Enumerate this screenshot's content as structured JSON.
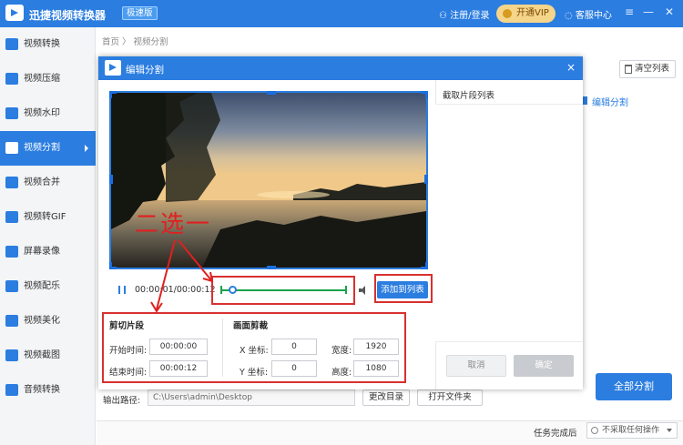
{
  "app": {
    "name": "迅捷视频转换器",
    "edition_badge": "极速版",
    "login_label": "注册/登录",
    "vip_label": "开通VIP",
    "support_label": "客服中心"
  },
  "sidebar": {
    "items": [
      {
        "label": "视频转换"
      },
      {
        "label": "视频压缩"
      },
      {
        "label": "视频水印"
      },
      {
        "label": "视频分割"
      },
      {
        "label": "视频合并"
      },
      {
        "label": "视频转GIF"
      },
      {
        "label": "屏幕录像"
      },
      {
        "label": "视频配乐"
      },
      {
        "label": "视频美化"
      },
      {
        "label": "视频截图"
      },
      {
        "label": "音频转换"
      }
    ],
    "active_index": 3
  },
  "breadcrumb": "首页 〉 视频分割",
  "main": {
    "clear_list_label": "清空列表",
    "right_item_label": "编辑分割",
    "split_all_label": "全部分割",
    "output_label": "输出路径:",
    "output_path": "C:\\Users\\admin\\Desktop",
    "change_dir_label": "更改目录",
    "open_folder_label": "打开文件夹",
    "on_complete_label": "任务完成后",
    "on_complete_value": "不采取任何操作"
  },
  "dialog": {
    "title": "编辑分割",
    "close": "×",
    "timecode": "00:00:01/00:00:12",
    "add_to_list_label": "添加到列表",
    "annotation": "二选一",
    "clip_section": "剪切片段",
    "start_label": "开始时间:",
    "start_value": "00:00:00",
    "end_label": "结束时间:",
    "end_value": "00:00:12",
    "crop_section": "画面剪裁",
    "x_label": "X 坐标:",
    "x_value": "0",
    "y_label": "Y 坐标:",
    "y_value": "0",
    "width_label": "宽度:",
    "width_value": "1920",
    "height_label": "高度:",
    "height_value": "1080",
    "clip_list_title": "截取片段列表",
    "cancel_label": "取消",
    "ok_label": "确定"
  },
  "colors": {
    "brand": "#2b7de0",
    "annotation_red": "#e02020",
    "track_green": "#18a34a"
  }
}
